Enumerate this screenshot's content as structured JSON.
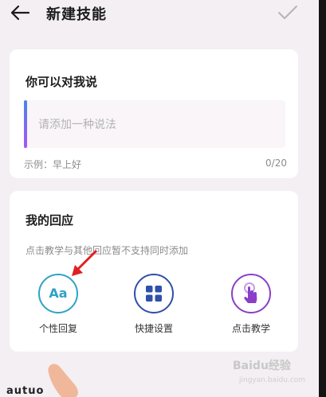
{
  "header": {
    "title": "新建技能",
    "back_icon": "arrow-left-icon",
    "confirm_icon": "check-icon"
  },
  "utterance_card": {
    "title": "你可以对我说",
    "input_placeholder": "请添加一种说法",
    "input_value": "",
    "example": "示例：早上好",
    "counter": "0/20"
  },
  "response_card": {
    "title": "我的回应",
    "hint": "点击教学与其他回应暂不支持同时添加",
    "options": [
      {
        "label": "个性回复",
        "icon": "aa-text-icon",
        "color": "#2ea3c4",
        "icon_text": "Aa"
      },
      {
        "label": "快捷设置",
        "icon": "grid-icon",
        "color": "#2f4fa8"
      },
      {
        "label": "点击教学",
        "icon": "tap-hand-icon",
        "color": "#8a3fc8"
      }
    ]
  },
  "overlay": {
    "bottom_text": "autuo",
    "watermark": "Baidu经验",
    "watermark_sub": "jingyan.baidu.com"
  }
}
